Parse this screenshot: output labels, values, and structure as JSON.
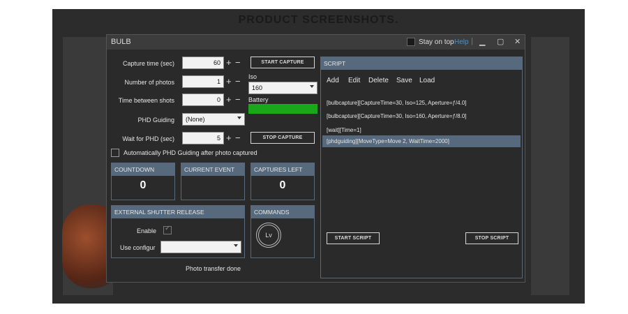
{
  "page_title": "PRODUCT SCREENSHOTS.",
  "window": {
    "title": "BULB",
    "stay_on_top": "Stay on top",
    "help": "Help"
  },
  "fields": {
    "capture_time": {
      "label": "Capture time (sec)",
      "value": "60"
    },
    "number_of_photos": {
      "label": "Number of photos",
      "value": "1"
    },
    "time_between": {
      "label": "Time between shots",
      "value": "0"
    },
    "phd_guiding": {
      "label": "PHD Guiding",
      "value": "(None)"
    },
    "wait_for_phd": {
      "label": "Wait for PHD (sec)",
      "value": "5"
    }
  },
  "buttons": {
    "start_capture": "START CAPTURE",
    "stop_capture": "STOP CAPTURE",
    "start_script": "START SCRIPT",
    "stop_script": "STOP SCRIPT"
  },
  "iso": {
    "label": "Iso",
    "value": "160"
  },
  "battery": {
    "label": "Battery",
    "color": "#1aa81a"
  },
  "auto_phd": "Automatically PHD Guiding after photo captured",
  "panels": {
    "countdown": {
      "title": "COUNTDOWN",
      "value": "0"
    },
    "current_event": {
      "title": "CURRENT EVENT",
      "value": ""
    },
    "captures_left": {
      "title": "CAPTURES LEFT",
      "value": "0"
    },
    "external_shutter": {
      "title": "EXTERNAL SHUTTER RELEASE",
      "enable": "Enable",
      "use_config": "Use configur"
    },
    "commands": {
      "title": "COMMANDS",
      "lv": "Lv"
    }
  },
  "script": {
    "title": "SCRIPT",
    "menu": [
      "Add",
      "Edit",
      "Delete",
      "Save",
      "Load"
    ],
    "lines": [
      "[bulbcapture][CaptureTime=30, Iso=125, Aperture=ƒ/4.0]",
      "[bulbcapture][CaptureTime=30, Iso=160, Aperture=ƒ/8.0]",
      "[wait][Time=1]",
      "[phdguiding][MoveType=Move 2, WaitTime=2000]"
    ]
  },
  "status": "Photo transfer done",
  "colors": {
    "accent": "#56697d",
    "battery": "#1aa81a"
  }
}
